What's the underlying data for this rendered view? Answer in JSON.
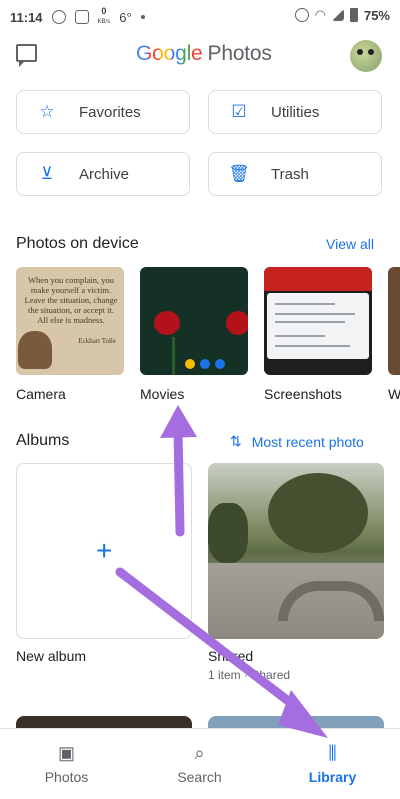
{
  "status_bar": {
    "time": "11:14",
    "speed_value": "0",
    "speed_unit": "KB/s",
    "temperature": "6°",
    "battery": "75%"
  },
  "header": {
    "logo_google": "Google",
    "logo_photos": "Photos"
  },
  "quick_buttons": [
    {
      "label": "Favorites",
      "icon": "star-icon"
    },
    {
      "label": "Utilities",
      "icon": "utilities-icon"
    },
    {
      "label": "Archive",
      "icon": "archive-icon"
    },
    {
      "label": "Trash",
      "icon": "trash-icon"
    }
  ],
  "device_section": {
    "title": "Photos on device",
    "view_all": "View all",
    "folders": [
      {
        "label": "Camera"
      },
      {
        "label": "Movies"
      },
      {
        "label": "Screenshots"
      },
      {
        "label": "W"
      }
    ],
    "camera_quote": "When you complain, you make yourself a victim. Leave the situation, change the situation, or accept it. All else is madness.",
    "camera_quote_author": "Eckhart Tolle"
  },
  "albums_section": {
    "title": "Albums",
    "sort_label": "Most recent photo",
    "albums": [
      {
        "title": "New album",
        "subtitle": ""
      },
      {
        "title": "Shared",
        "subtitle": "1 item · Shared"
      }
    ]
  },
  "bottom_nav": [
    {
      "label": "Photos",
      "icon": "photo-icon",
      "active": false
    },
    {
      "label": "Search",
      "icon": "search-icon",
      "active": false
    },
    {
      "label": "Library",
      "icon": "library-icon",
      "active": true
    }
  ],
  "colors": {
    "accent": "#1a73e8",
    "arrow": "#a46ee0"
  }
}
